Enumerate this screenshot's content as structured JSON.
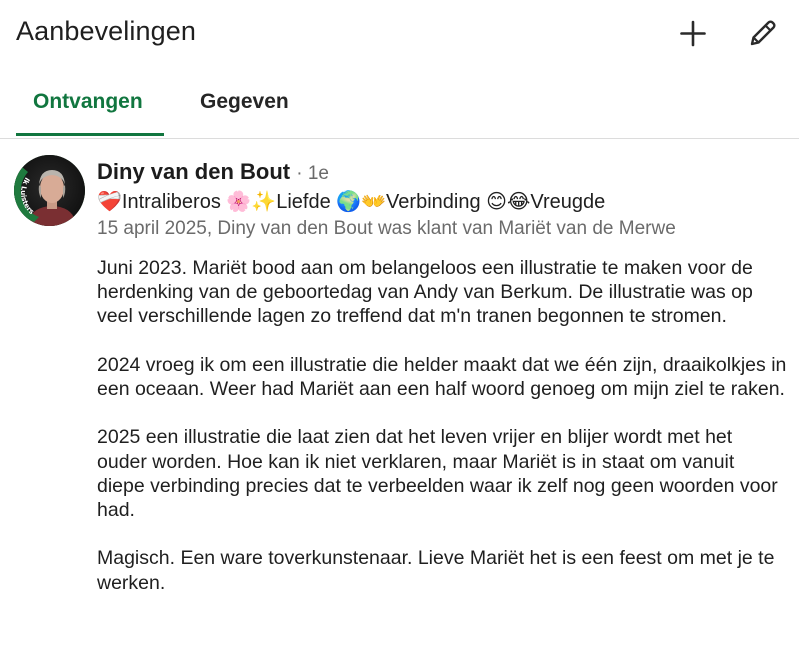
{
  "header": {
    "title": "Aanbevelingen",
    "add_icon": "plus-icon",
    "edit_icon": "pencil-icon"
  },
  "tabs": [
    {
      "label": "Ontvangen",
      "active": true
    },
    {
      "label": "Gegeven",
      "active": false
    }
  ],
  "colors": {
    "accent": "#11763f",
    "text": "#1f1f1f",
    "muted": "#6b6b6b",
    "divider": "#dcdcdc"
  },
  "recommendation": {
    "avatar_badge": "Ik Luisters",
    "name": "Diny van den Bout",
    "degree": "· 1e",
    "headline": "❤️‍🩹Intraliberos 🌸✨Liefde 🌍👐Verbinding 😊😂Vreugde",
    "meta": "15 april 2025, Diny van den Bout was klant van Mariët van de Merwe",
    "paragraphs": [
      "Juni 2023. Mariët bood aan om belangeloos een illustratie te maken voor de herdenking van de geboortedag van Andy van Berkum. De illustratie was op veel verschillende lagen zo treffend dat m'n tranen begonnen te stromen.",
      "2024 vroeg ik om een illustratie die helder maakt dat we één zijn, draaikolkjes in een oceaan. Weer had Mariët aan een half woord genoeg om mijn ziel te raken.",
      "2025 een illustratie die laat zien dat het leven vrijer en blijer wordt met het ouder worden. Hoe kan ik niet verklaren, maar Mariët is in staat om vanuit diepe verbinding precies dat te verbeelden waar ik zelf nog geen woorden voor had.",
      "Magisch. Een ware toverkunstenaar. Lieve Mariët het is een feest om met je te werken."
    ]
  }
}
